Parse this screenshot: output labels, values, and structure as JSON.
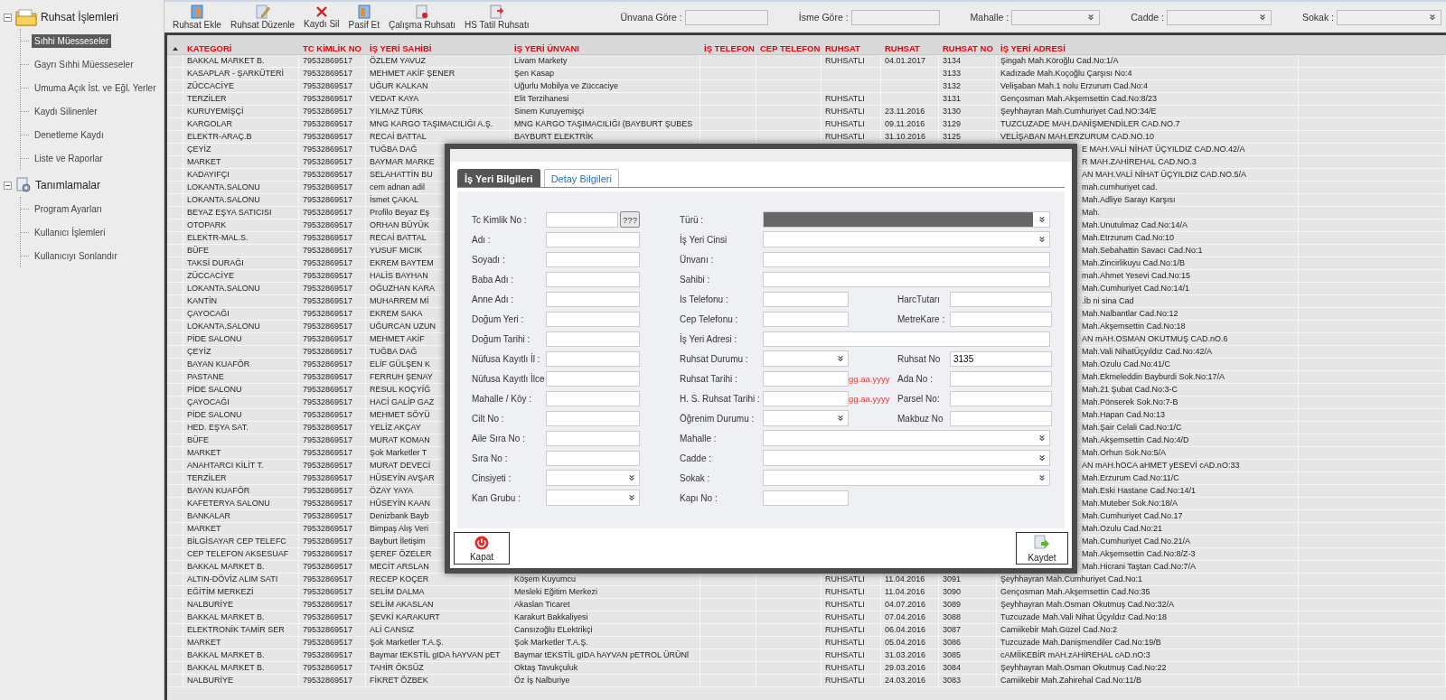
{
  "sidebar": {
    "groups": [
      {
        "label": "Ruhsat İşlemleri",
        "kind": "folder",
        "expanded": true,
        "children": [
          {
            "label": "Sıhhi Müesseseler",
            "selected": true
          },
          {
            "label": "Gayrı Sıhhi Müesseseler",
            "selected": false
          },
          {
            "label": "Umuma Açık İst. ve Eğl. Yerler",
            "selected": false
          },
          {
            "label": "Kaydı Silinenler",
            "selected": false
          },
          {
            "label": "Denetleme Kaydı",
            "selected": false
          },
          {
            "label": "Liste ve Raporlar",
            "selected": false
          }
        ]
      },
      {
        "label": "Tanımlamalar",
        "kind": "tools",
        "expanded": true,
        "children": [
          {
            "label": "Program Ayarları",
            "selected": false
          },
          {
            "label": "Kullanıcı İşlemleri",
            "selected": false
          },
          {
            "label": "Kullanıcıyı Sonlandır",
            "selected": false
          }
        ]
      }
    ]
  },
  "toolbar": {
    "buttons": [
      {
        "label": "Ruhsat Ekle",
        "kind": "add"
      },
      {
        "label": "Ruhsat Düzenle",
        "kind": "edit"
      },
      {
        "label": "Kaydı Sil",
        "kind": "delete"
      },
      {
        "label": "Pasif Et",
        "kind": "deactivate"
      },
      {
        "label": "Çalışma Ruhsatı",
        "kind": "permit"
      },
      {
        "label": "HS Tatil Ruhsatı",
        "kind": "holiday"
      }
    ],
    "filters": [
      {
        "label": "Ünvana Göre :",
        "kind": "text"
      },
      {
        "label": "İsme Göre :",
        "kind": "text"
      },
      {
        "label": "Mahalle :",
        "kind": "select"
      },
      {
        "label": "Cadde :",
        "kind": "select"
      },
      {
        "label": "Sokak :",
        "kind": "select"
      }
    ]
  },
  "table": {
    "columns": [
      "KATEGORİ",
      "TC KİMLİK NO",
      "İŞ YERİ SAHİBİ",
      "İŞ YERİ ÜNVANI",
      "İŞ TELEFON",
      "CEP TELEFON",
      "RUHSAT",
      "RUHSAT",
      "RUHSAT NO",
      "İŞ YERİ ADRESİ"
    ],
    "rows_above_dialog": [
      {
        "category": "BAKKAL MARKET B.",
        "tc_no": "79532869517",
        "owner": "ÖZLEM YAVUZ",
        "title": "Livam Markety",
        "status": "RUHSATLI",
        "date": "04.01.2017",
        "license_no": "3134",
        "address": "Şingah Mah.Köroğlu Cad.No:1/A"
      },
      {
        "category": "KASAPLAR - ŞARKÜTERİ",
        "tc_no": "79532869517",
        "owner": "MEHMET AKİF ŞENER",
        "title": "Şen Kasap",
        "license_no": "3133",
        "address": "Kadızade Mah.Koçoğlu Çarşısı No:4"
      },
      {
        "category": "ZÜCCACİYE",
        "tc_no": "79532869517",
        "owner": "UĞUR KALKAN",
        "title": "Uğurlu Mobilya ve Züccaciye",
        "license_no": "3132",
        "address": "Velişaban Mah.1 nolu Erzurum Cad.No:4"
      },
      {
        "category": "TERZİLER",
        "tc_no": "79532869517",
        "owner": "VEDAT KAYA",
        "title": "Elit Terzihanesi",
        "status": "RUHSATLI",
        "license_no": "3131",
        "address": "Gençosman Mah.Akşemsettin Cad.No:8/23"
      },
      {
        "category": "KURUYEMİŞÇİ",
        "tc_no": "79532869517",
        "owner": "YILMAZ TÜRK",
        "title": "Sinem Kuruyemişçi",
        "status": "RUHSATLI",
        "date": "23.11.2016",
        "license_no": "3130",
        "address": "Şeyhhayran Mah.Cumhuriyet Cad.NO:34/E"
      },
      {
        "category": "KARGOLAR",
        "tc_no": "79532869517",
        "owner": "MNG KARGO TAŞIMACILIĞI A.Ş.",
        "title": "MNG KARGO TAŞIMACILIĞI (BAYBURT ŞUBES",
        "status": "RUHSATLI",
        "date": "09.11.2016",
        "license_no": "3129",
        "address": "TUZCUZADE MAH.DANİŞMENDİLER CAD.NO.7"
      },
      {
        "category": "ELEKTR-ARAÇ.B",
        "tc_no": "79532869517",
        "owner": "RECAİ BATTAL",
        "title": "BAYBURT ELEKTRİK",
        "status": "RUHSATLI",
        "date": "31.10.2016",
        "license_no": "3125",
        "address": "VELİŞABAN MAH.ERZURUM CAD.NO.10"
      }
    ],
    "rows_beside_dialog": [
      {
        "category": "ÇEYİZ",
        "tc_no": "79532869517",
        "owner": "TUĞBA DAĞ",
        "address": "E MAH.VALİ NİHAT ÜÇYILDIZ CAD.NO.42/A"
      },
      {
        "category": "MARKET",
        "tc_no": "79532869517",
        "owner": "BAYMAR MARKE",
        "address": "R MAH.ZAHİREHAL CAD.NO.3"
      },
      {
        "category": "KADAYIFÇI",
        "tc_no": "79532869517",
        "owner": "SELAHATTİN BU",
        "address": "AN MAH.VALİ NİHAT ÜÇYILDIZ CAD.NO.5/A"
      },
      {
        "category": "LOKANTA.SALONU",
        "tc_no": "79532869517",
        "owner": "cem adnan adil",
        "address": "mah.cumhuriyet cad."
      },
      {
        "category": "LOKANTA.SALONU",
        "tc_no": "79532869517",
        "owner": "İsmet ÇAKAL",
        "address": "Mah.Adliye Sarayı Karşısı"
      },
      {
        "category": "BEYAZ EŞYA SATICISI",
        "tc_no": "79532869517",
        "owner": "Profilo Beyaz Eş",
        "address": "Mah."
      },
      {
        "category": "OTOPARK",
        "tc_no": "79532869517",
        "owner": "ORHAN BÜYÜK",
        "address": "Mah.Unutulmaz Cad.No:14/A"
      },
      {
        "category": "ELEKTR-MAL.S.",
        "tc_no": "79532869517",
        "owner": "RECAİ BATTAL",
        "address": "Mah.Etrzurum Cad.No:10"
      },
      {
        "category": "BÜFE",
        "tc_no": "79532869517",
        "owner": "YUSUF MICIK",
        "address": "Mah.Sebahattin Savacı Cad.No:1"
      },
      {
        "category": "TAKSİ DURAĞI",
        "tc_no": "79532869517",
        "owner": "EKREM BAYTEM",
        "address": "Mah.Zincirlikuyu Cad.No:1/B"
      },
      {
        "category": "ZÜCCACİYE",
        "tc_no": "79532869517",
        "owner": "HALİS BAYHAN",
        "address": "mah.Ahmet Yesevi Cad.No:15"
      },
      {
        "category": "LOKANTA.SALONU",
        "tc_no": "79532869517",
        "owner": "OĞUZHAN KARA",
        "address": "Mah.Cumhuriyet Cad.No:14/1"
      },
      {
        "category": "KANTİN",
        "tc_no": "79532869517",
        "owner": "MUHARREM Mİ",
        "address": ".İb ni sina Cad"
      },
      {
        "category": "ÇAYOCAĞI",
        "tc_no": "79532869517",
        "owner": "EKREM SAKA",
        "address": "Mah.Nalbantlar Cad.No:12"
      },
      {
        "category": "LOKANTA.SALONU",
        "tc_no": "79532869517",
        "owner": "UĞURCAN UZUN",
        "address": "Mah.Akşemsettin Cad.No:18"
      },
      {
        "category": "PİDE SALONU",
        "tc_no": "79532869517",
        "owner": "MEHMET AKİF",
        "address": "AN mAH.OSMAN OKUTMUŞ CAD.nO.6"
      },
      {
        "category": "ÇEYİZ",
        "tc_no": "79532869517",
        "owner": "TUĞBA DAĞ",
        "address": "Mah.Vali NihatÜçyıldız Cad.No:42/A"
      },
      {
        "category": "BAYAN KUAFÖR",
        "tc_no": "79532869517",
        "owner": "ELİF GÜLŞEN K",
        "address": "Mah.Ozulu Cad.No:41/C"
      },
      {
        "category": "PASTANE",
        "tc_no": "79532869517",
        "owner": "FERRUH ŞENAY",
        "address": "Mah.Ekmeleddin Bayburdi Sok.No:17/A"
      },
      {
        "category": "PİDE SALONU",
        "tc_no": "79532869517",
        "owner": "RESUL KOÇYİĞ",
        "address": "Mah.21 Şubat Cad.No:3-C"
      },
      {
        "category": "ÇAYOCAĞI",
        "tc_no": "79532869517",
        "owner": "HACİ GALİP GAZ",
        "address": "Mah.Pönserek Sok.No:7-B"
      },
      {
        "category": "PİDE SALONU",
        "tc_no": "79532869517",
        "owner": "MEHMET SÖYÜ",
        "address": "Mah.Hapan Cad.No:13"
      },
      {
        "category": "HED. EŞYA SAT.",
        "tc_no": "79532869517",
        "owner": "YELİZ AKÇAY",
        "address": "Mah.Şair Celali Cad.No:1/C"
      },
      {
        "category": "BÜFE",
        "tc_no": "79532869517",
        "owner": "MURAT KOMAN",
        "address": "Mah.Akşemsettin Cad.No:4/D"
      },
      {
        "category": "MARKET",
        "tc_no": "79532869517",
        "owner": "Şok Marketler T",
        "address": "Mah.Orhun Sok.No:5/A"
      },
      {
        "category": "ANAHTARCI  KİLİT  T.",
        "tc_no": "79532869517",
        "owner": "MURAT DEVECİ",
        "address": "AN mAH.hOCA aHMET yESEVİ cAD.nO:33"
      },
      {
        "category": "TERZİLER",
        "tc_no": "79532869517",
        "owner": "HÜSEYİN AVŞAR",
        "address": "Mah.Erzurum Cad.No:11/C"
      },
      {
        "category": "BAYAN KUAFÖR",
        "tc_no": "79532869517",
        "owner": "ÖZAY YAYA",
        "address": "Mah.Eski Hastane Cad.No:14/1"
      },
      {
        "category": "KAFETERYA SALONU",
        "tc_no": "79532869517",
        "owner": "HÜSEYİN KAAN",
        "address": "Mah.Muteber Sok.No:18/A"
      },
      {
        "category": "BANKALAR",
        "tc_no": "79532869517",
        "owner": "Denizbank Bayb",
        "address": "Mah.Cumhuriyet Cad.No.17"
      },
      {
        "category": "MARKET",
        "tc_no": "79532869517",
        "owner": "Bimpaş Alış Veri",
        "address": "Mah.Ozulu Cad.No:21"
      },
      {
        "category": "BİLGİSAYAR CEP TELEFC",
        "tc_no": "79532869517",
        "owner": "Bayburt İletişim",
        "address": "Mah.Cumhuriyet Cad.No.21/A"
      },
      {
        "category": "CEP TELEFON AKSESUAF",
        "tc_no": "79532869517",
        "owner": "ŞEREF ÖZELER",
        "address": "Mah.Akşemsettin Cad.No:8/Z-3"
      },
      {
        "category": "BAKKAL MARKET B.",
        "tc_no": "79532869517",
        "owner": "MECİT ARSLAN",
        "address": "Mah.Hicrani Taştan Cad.No:7/A"
      }
    ],
    "rows_below_dialog": [
      {
        "category": "ALTIN-DÖVİZ ALIM SATI",
        "tc_no": "79532869517",
        "owner": "RECEP KOÇER",
        "title": "Köşem Kuyumcu",
        "status": "RUHSATLI",
        "date": "11.04.2016",
        "license_no": "3091",
        "address": "Şeyhhayran Mah.Cumhuriyet Cad.No:1"
      },
      {
        "category": "EĞİTİM MERKEZİ",
        "tc_no": "79532869517",
        "owner": "SELİM DALMA",
        "title": "Mesleki Eğitim Merkezi",
        "status": "RUHSATLI",
        "date": "11.04.2016",
        "license_no": "3090",
        "address": "Gençosman Mah.Akşemsettin Cad.No:35"
      },
      {
        "category": "NALBURİYE",
        "tc_no": "79532869517",
        "owner": "SELİM AKASLAN",
        "title": "Akaslan Ticaret",
        "status": "RUHSATLI",
        "date": "04.07.2016",
        "license_no": "3089",
        "address": "Şeyhhayran Mah.Osman Okutmuş Cad.No:32/A"
      },
      {
        "category": "BAKKAL MARKET B.",
        "tc_no": "79532869517",
        "owner": "ŞEVKİ KARAKURT",
        "title": "Karakurt Bakkaliyesi",
        "status": "RUHSATLI",
        "date": "07.04.2016",
        "license_no": "3088",
        "address": "Tuzcuzade Mah.Vali Nihat Üçyıldız Cad.No:18"
      },
      {
        "category": "ELEKTRONİK TAMİR SER",
        "tc_no": "79532869517",
        "owner": "ALİ CANSIZ",
        "title": "Cansızoğlu ELektrikçi",
        "status": "RUHSATLI",
        "date": "06.04.2016",
        "license_no": "3087",
        "address": "Camiikebir Mah.Güzel Cad.No:2"
      },
      {
        "category": "MARKET",
        "tc_no": "79532869517",
        "owner": "Şok Marketler T.A.Ş.",
        "title": "Şok Marketler T.A.Ş.",
        "status": "RUHSATLI",
        "date": "05.04.2016",
        "license_no": "3086",
        "address": "Tuzcuzade Mah.Danişmendiler Cad.No:19/B"
      },
      {
        "category": "BAKKAL MARKET B.",
        "tc_no": "79532869517",
        "owner": "Baymar tEKSTİL gIDA hAYVAN pET",
        "title": "Baymar tEKSTİL gIDA hAYVAN pETROL ÜRÜNl",
        "status": "RUHSATLI",
        "date": "31.03.2016",
        "license_no": "3085",
        "address": "cAMİİKEBİR mAH.zAHİREHAL cAD.nO:3"
      },
      {
        "category": "BAKKAL MARKET B.",
        "tc_no": "79532869517",
        "owner": "TAHİR ÖKSÜZ",
        "title": "Oktaş Tavukçuluk",
        "status": "RUHSATLI",
        "date": "29.03.2016",
        "license_no": "3084",
        "address": "Şeyhhayran Mah.Osman Okutmuş Cad.No:22"
      },
      {
        "category": "NALBURİYE",
        "tc_no": "79532869517",
        "owner": "FİKRET ÖZBEK",
        "title": "Öz İş Nalburiye",
        "status": "RUHSATLI",
        "date": "24.03.2016",
        "license_no": "3083",
        "address": "Camiikebir Mah.Zahirehal Cad.No:11/B"
      }
    ]
  },
  "dialog": {
    "tabs": [
      {
        "label": "İş Yeri Bilgileri",
        "selected": true
      },
      {
        "label": "Detay Bilgileri",
        "selected": false
      }
    ],
    "left_fields": [
      {
        "label": "Tc Kimlik No :",
        "kind": "text",
        "button": "???"
      },
      {
        "label": "Adı :",
        "kind": "text"
      },
      {
        "label": "Soyadı :",
        "kind": "text"
      },
      {
        "label": "Baba Adı :",
        "kind": "text"
      },
      {
        "label": "Anne Adı :",
        "kind": "text"
      },
      {
        "label": "Doğum Yeri :",
        "kind": "text"
      },
      {
        "label": "Doğum Tarihi :",
        "kind": "text"
      },
      {
        "label": "Nüfusa Kayıtlı İl :",
        "kind": "text"
      },
      {
        "label": "Nüfusa Kayıtlı İlce",
        "kind": "text"
      },
      {
        "label": "Mahalle / Köy :",
        "kind": "text"
      },
      {
        "label": "Cilt No :",
        "kind": "text"
      },
      {
        "label": "Aile Sıra No :",
        "kind": "text"
      },
      {
        "label": "Sıra No :",
        "kind": "text"
      },
      {
        "label": "Cinsiyeti :",
        "kind": "select"
      },
      {
        "label": "Kan Grubu :",
        "kind": "select"
      }
    ],
    "right_fields": [
      {
        "label": "Türü :",
        "kind": "wideselect",
        "disabled": true
      },
      {
        "label": "İş Yeri Cinsi",
        "kind": "wideselect",
        "disabled": false
      },
      {
        "label": "Ünvanı :",
        "kind": "wide",
        "disabled": false
      },
      {
        "label": "Sahibi :",
        "kind": "wide",
        "disabled": false
      },
      {
        "label": "Is Telefonu :",
        "kind": "short",
        "disabled": false,
        "side": {
          "label": "HarcTutarı"
        }
      },
      {
        "label": "Cep Telefonu :",
        "kind": "short",
        "disabled": false,
        "side": {
          "label": "MetreKare :"
        }
      },
      {
        "label": "İş Yeri Adresi :",
        "kind": "wide",
        "disabled": false
      },
      {
        "label": "Ruhsat Durumu :",
        "kind": "shortselect",
        "disabled": false,
        "side": {
          "label": "Ruhsat No",
          "value": "3135"
        }
      },
      {
        "label": "Ruhsat Tarihi :",
        "kind": "short",
        "disabled": false,
        "hint": "gg.aa.yyyy",
        "side": {
          "label": "Ada No :"
        }
      },
      {
        "label": "H. S. Ruhsat Tarihi :",
        "kind": "short",
        "disabled": false,
        "hint": "gg.aa.yyyy",
        "side": {
          "label": "Parsel No:"
        }
      },
      {
        "label": "Öğrenim Durumu :",
        "kind": "shortselect",
        "disabled": false,
        "side": {
          "label": "Makbuz No"
        }
      },
      {
        "label": "Mahalle :",
        "kind": "wideselect",
        "disabled": false
      },
      {
        "label": "Cadde :",
        "kind": "wideselect",
        "disabled": false
      },
      {
        "label": "Sokak :",
        "kind": "wideselect",
        "disabled": false
      },
      {
        "label": "Kapı No :",
        "kind": "short",
        "disabled": false
      }
    ],
    "buttons": [
      {
        "label": "Kapat",
        "kind": "close"
      },
      {
        "label": "Kaydet",
        "kind": "save"
      }
    ]
  }
}
